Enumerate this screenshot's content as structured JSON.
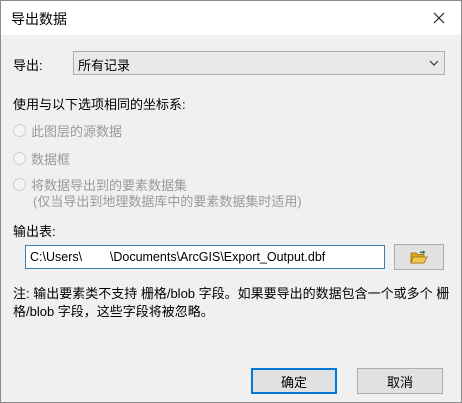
{
  "window": {
    "title": "导出数据",
    "close_icon": "close-icon"
  },
  "export": {
    "label": "导出:",
    "selected": "所有记录"
  },
  "coords": {
    "label": "使用与以下选项相同的坐标系:"
  },
  "options": [
    {
      "label": "此图层的源数据"
    },
    {
      "label": "数据框"
    },
    {
      "label": "将数据导出到的要素数据集",
      "sublabel": "(仅当导出到地理数据库中的要素数据集时适用)"
    }
  ],
  "output": {
    "label": "输出表:",
    "path": "C:\\Users\\        \\Documents\\ArcGIS\\Export_Output.dbf"
  },
  "note": "注: 输出要素类不支持 栅格/blob 字段。如果要导出的数据包含一个或多个 栅格/blob 字段，这些字段将被忽略。",
  "buttons": {
    "ok": "确定",
    "cancel": "取消"
  },
  "colors": {
    "accent": "#0078d7",
    "folder": "#e8b531"
  }
}
